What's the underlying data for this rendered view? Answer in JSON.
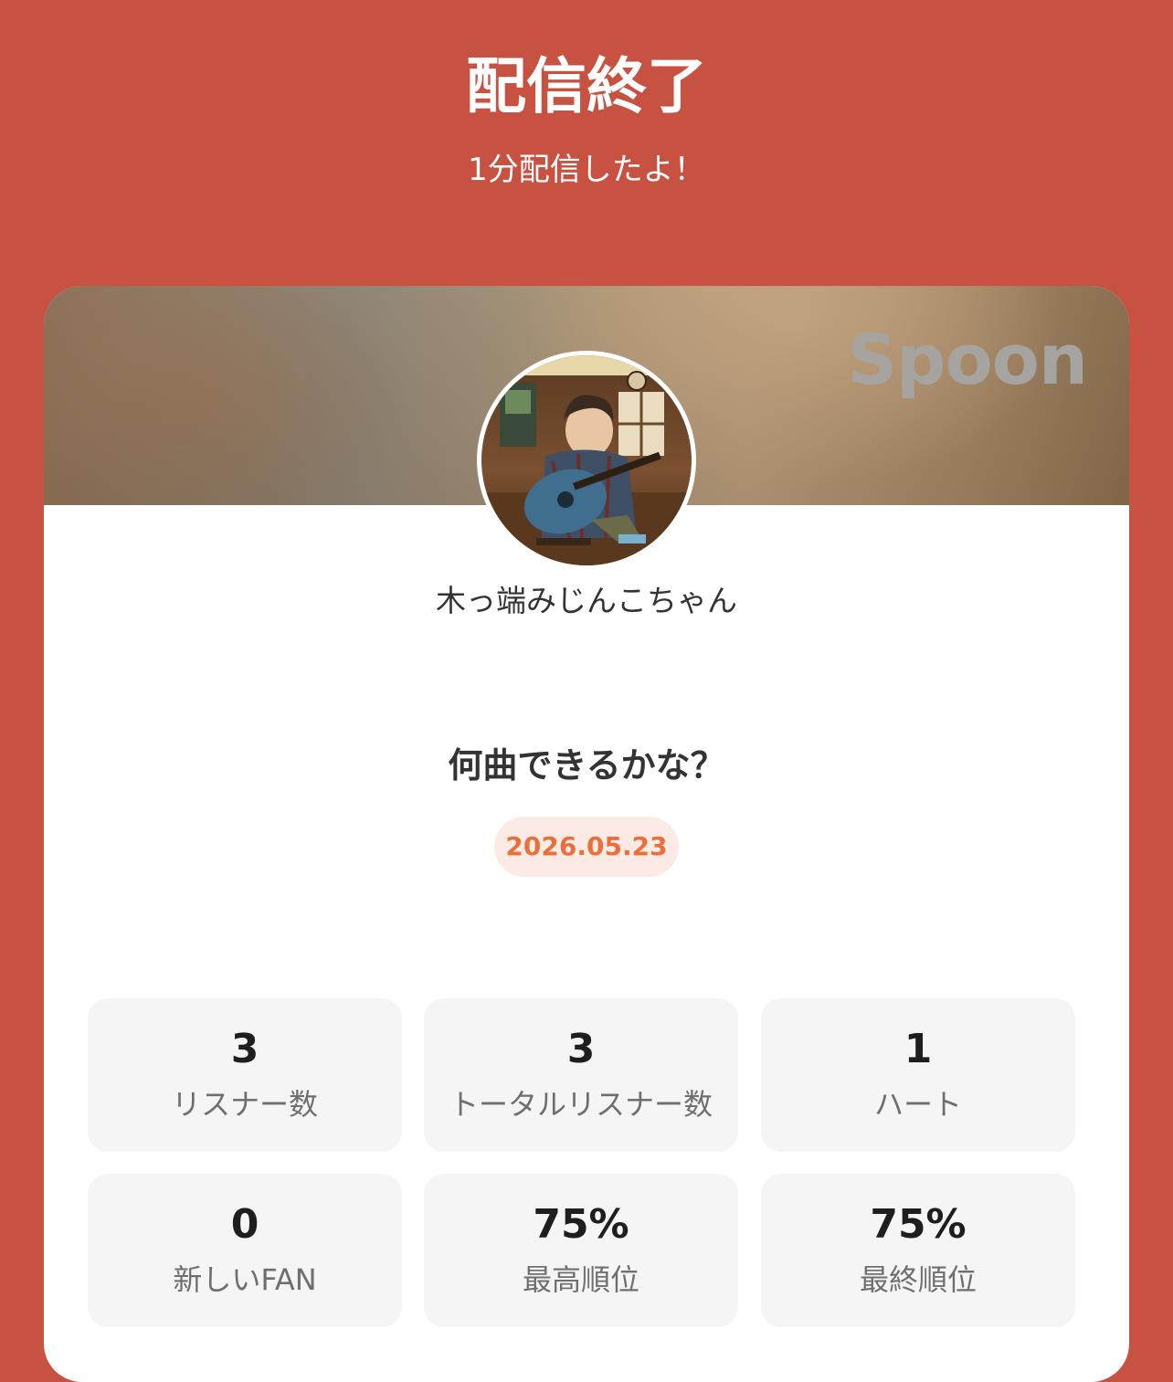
{
  "header": {
    "title": "配信終了",
    "subtitle": "1分配信したよ！"
  },
  "card": {
    "brand": "Spoon",
    "username": "木っ端みじんこちゃん",
    "stream_title": "何曲できるかな？",
    "date": "2026.05.23"
  },
  "stats": [
    {
      "value": "3",
      "label": "リスナー数"
    },
    {
      "value": "3",
      "label": "トータルリスナー数"
    },
    {
      "value": "1",
      "label": "ハート"
    },
    {
      "value": "0",
      "label": "新しいFAN"
    },
    {
      "value": "75%",
      "label": "最高順位"
    },
    {
      "value": "75%",
      "label": "最終順位"
    }
  ],
  "colors": {
    "background": "#c75242",
    "date_text": "#e9703d",
    "date_pill": "#fceae4",
    "stat_box": "#f5f5f5"
  },
  "icons": {
    "avatar": "user-avatar-image"
  }
}
